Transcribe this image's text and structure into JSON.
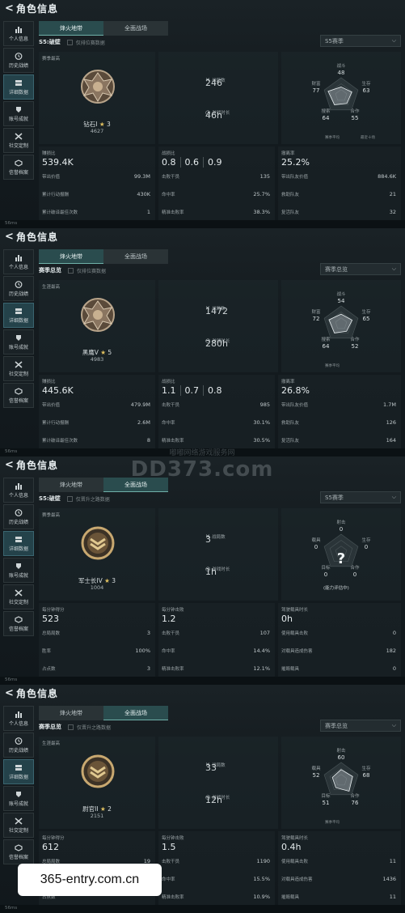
{
  "panels": [
    {
      "title": "角色信息",
      "sidebar": [
        "个人信息",
        "历史战绩",
        "详细数据",
        "账号成就",
        "社交定制",
        "信誉档案"
      ],
      "active_sidebar": 2,
      "tabs": [
        "烽火地带",
        "全面战场"
      ],
      "active_tab": 0,
      "season": "S5:破壁",
      "checkbox_label": "仅排位赛数据",
      "dropdown": "S5赛季",
      "best_label": "赛季最高",
      "rank": "钻石I",
      "stars": "3",
      "points": "4627",
      "stat1_label": "战局数",
      "stat1_value": "246",
      "stat2_label": "游戏时长",
      "stat2_value": "46h",
      "radar": {
        "top_n": "战斗",
        "top_v": "48",
        "right_n": "生存",
        "right_v": "63",
        "left_n": "财富",
        "left_v": "77",
        "bl_n": "搜索",
        "bl_v": "64",
        "br_n": "合作",
        "br_v": "55",
        "legend1": "赛季平均",
        "legend2": "最近十场",
        "values": [
          48,
          63,
          55,
          64,
          77
        ]
      },
      "col1": {
        "head": "赚损比",
        "big": "539.4K",
        "rows": [
          [
            "带出价值",
            "99.3M"
          ],
          [
            "累计行动报酬",
            "430K"
          ],
          [
            "累计破译最佳次数",
            "1"
          ]
        ]
      },
      "col2": {
        "head": "战损比",
        "kd": [
          "0.8",
          "0.6",
          "0.9"
        ],
        "rows": [
          [
            "击败干员",
            "135"
          ],
          [
            "命中率",
            "25.7%"
          ],
          [
            "精准击败率",
            "38.3%"
          ]
        ]
      },
      "col3": {
        "head": "撤离率",
        "big": "25.2%",
        "rows": [
          [
            "带出队友价值",
            "884.6K"
          ],
          [
            "救助队友",
            "21"
          ],
          [
            "复活队友",
            "32"
          ]
        ]
      }
    },
    {
      "title": "角色信息",
      "sidebar": [
        "个人信息",
        "历史战绩",
        "详细数据",
        "账号成就",
        "社交定制",
        "信誉档案"
      ],
      "active_sidebar": 2,
      "tabs": [
        "烽火地带",
        "全面战场"
      ],
      "active_tab": 0,
      "season": "赛季总览",
      "checkbox_label": "仅排位赛数据",
      "dropdown": "赛季总览",
      "best_label": "生涯最高",
      "rank": "黑鹰V",
      "stars": "5",
      "points": "4983",
      "stat1_label": "战局数",
      "stat1_value": "1472",
      "stat2_label": "游戏时长",
      "stat2_value": "280h",
      "radar": {
        "top_n": "战斗",
        "top_v": "54",
        "right_n": "生存",
        "right_v": "65",
        "left_n": "财富",
        "left_v": "72",
        "bl_n": "搜索",
        "bl_v": "64",
        "br_n": "合作",
        "br_v": "52",
        "legend1": "赛季平均",
        "legend2": "",
        "values": [
          54,
          65,
          52,
          64,
          72
        ]
      },
      "col1": {
        "head": "赚损比",
        "big": "445.6K",
        "rows": [
          [
            "带出价值",
            "479.9M"
          ],
          [
            "累计行动报酬",
            "2.6M"
          ],
          [
            "累计破译最佳次数",
            "8"
          ]
        ]
      },
      "col2": {
        "head": "战损比",
        "kd": [
          "1.1",
          "0.7",
          "0.8"
        ],
        "rows": [
          [
            "击败干员",
            "985"
          ],
          [
            "命中率",
            "30.1%"
          ],
          [
            "精准击败率",
            "30.5%"
          ]
        ]
      },
      "col3": {
        "head": "撤离率",
        "big": "26.8%",
        "rows": [
          [
            "带出队友价值",
            "1.7M"
          ],
          [
            "救助队友",
            "126"
          ],
          [
            "复活队友",
            "164"
          ]
        ]
      }
    },
    {
      "title": "角色信息",
      "sidebar": [
        "个人信息",
        "历史战绩",
        "详细数据",
        "账号成就",
        "社交定制",
        "信誉档案"
      ],
      "active_sidebar": 2,
      "tabs": [
        "烽火地带",
        "全面战场"
      ],
      "active_tab": 1,
      "season": "S5:破壁",
      "checkbox_label": "仅晋升之路数据",
      "dropdown": "S5赛季",
      "best_label": "赛季最高",
      "rank": "军士长IV",
      "stars": "3",
      "points": "1004",
      "stat1_label": "战局数",
      "stat1_value": "3",
      "stat2_label": "游戏时长",
      "stat2_value": "1h",
      "radar": {
        "top_n": "射击",
        "top_v": "0",
        "right_n": "生存",
        "right_v": "0",
        "left_n": "载具",
        "left_v": "0",
        "bl_n": "目标",
        "bl_v": "0",
        "br_n": "合作",
        "br_v": "0",
        "legend1": "",
        "legend2": "",
        "unknown": "?",
        "ability": "(能力评估中)",
        "values": [
          0,
          0,
          0,
          0,
          0
        ]
      },
      "col1": {
        "head": "每分钟得分",
        "big": "523",
        "rows": [
          [
            "总局局数",
            "3"
          ],
          [
            "胜率",
            "100%"
          ],
          [
            "占点数",
            "3"
          ]
        ]
      },
      "col2": {
        "head": "每分钟击败",
        "big": "1.2",
        "rows": [
          [
            "击败干员",
            "107"
          ],
          [
            "命中率",
            "14.4%"
          ],
          [
            "精准击败率",
            "12.1%"
          ]
        ]
      },
      "col3": {
        "head": "驾驶载具时长",
        "big": "0h",
        "rows": [
          [
            "使用载具击败",
            "0"
          ],
          [
            "对载具造成伤害",
            "182"
          ],
          [
            "摧毁载具",
            "0"
          ]
        ]
      }
    },
    {
      "title": "角色信息",
      "sidebar": [
        "个人信息",
        "历史战绩",
        "详细数据",
        "账号成就",
        "社交定制",
        "信誉档案"
      ],
      "active_sidebar": 2,
      "tabs": [
        "烽火地带",
        "全面战场"
      ],
      "active_tab": 1,
      "season": "赛季总览",
      "checkbox_label": "仅晋升之路数据",
      "dropdown": "赛季总览",
      "best_label": "生涯最高",
      "rank": "尉官II",
      "stars": "2",
      "points": "2151",
      "stat1_label": "战局数",
      "stat1_value": "33",
      "stat2_label": "游戏时长",
      "stat2_value": "12h",
      "radar": {
        "top_n": "射击",
        "top_v": "60",
        "right_n": "生存",
        "right_v": "68",
        "left_n": "载具",
        "left_v": "52",
        "bl_n": "目标",
        "bl_v": "51",
        "br_n": "合作",
        "br_v": "76",
        "legend1": "赛季平均",
        "legend2": "",
        "values": [
          60,
          68,
          76,
          51,
          52
        ]
      },
      "col1": {
        "head": "每分钟得分",
        "big": "612",
        "rows": [
          [
            "总局局数",
            "19"
          ],
          [
            "胜率",
            ""
          ],
          [
            "占点数",
            ""
          ]
        ]
      },
      "col2": {
        "head": "每分钟击败",
        "big": "1.5",
        "rows": [
          [
            "击败干员",
            "1190"
          ],
          [
            "命中率",
            "15.5%"
          ],
          [
            "精准击败率",
            "10.9%"
          ]
        ]
      },
      "col3": {
        "head": "驾驶载具时长",
        "big": "0.4h",
        "rows": [
          [
            "使用载具击败",
            "11"
          ],
          [
            "对载具造成伤害",
            "1436"
          ],
          [
            "摧毁载具",
            "11"
          ]
        ]
      }
    }
  ],
  "watermark_cn": "嘟嘟网络游戏服务网",
  "watermark_en": "DD373.com",
  "site_url": "365-entry.com.cn",
  "status_signal": "56ms"
}
